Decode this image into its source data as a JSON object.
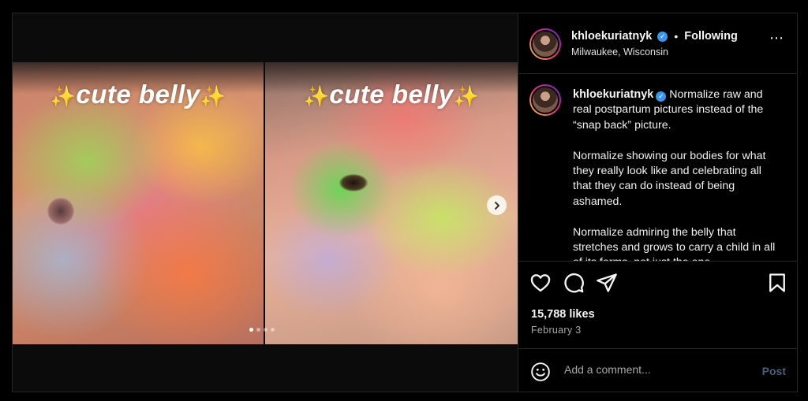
{
  "post": {
    "username": "khloekuriatnyk",
    "verified_mark": "✓",
    "separator": "•",
    "follow_label": "Following",
    "location": "Milwaukee, Wisconsin",
    "more_icon": "⋯"
  },
  "media": {
    "overlay_text_left": "cute belly",
    "overlay_text_right": "cute belly",
    "sparkle": "✨",
    "next_icon": "›",
    "slide_count": 4,
    "active_slide": 1
  },
  "caption": {
    "username": "khloekuriatnyk",
    "text": " Normalize raw and real postpartum pictures instead of the “snap back” picture.\n\nNormalize showing our bodies for what they really look like and celebrating all that they can do instead of being ashamed.\n\nNormalize admiring the belly that stretches and grows to carry a child in all of its forms, not just the one"
  },
  "actions": {
    "like_icon": "heart-icon",
    "comment_icon": "comment-icon",
    "share_icon": "share-icon",
    "save_icon": "bookmark-icon"
  },
  "stats": {
    "likes": "15,788 likes",
    "date": "February 3"
  },
  "comment": {
    "placeholder": "Add a comment...",
    "post_label": "Post"
  },
  "colors": {
    "background": "#000000",
    "border": "#262626",
    "verified": "#3797f0",
    "post_disabled": "#4a5d7a"
  }
}
